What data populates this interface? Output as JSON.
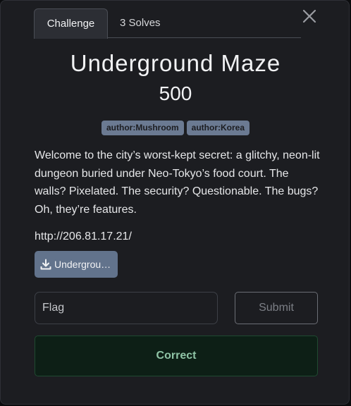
{
  "tabs": [
    {
      "label": "Challenge",
      "active": true
    },
    {
      "label": "3 Solves",
      "active": false
    }
  ],
  "challenge": {
    "name": "Underground Maze",
    "points": "500",
    "tags": [
      "author:Mushroom",
      "author:Korea"
    ],
    "description": "Welcome to the city’s worst-kept secret: a glitchy, neon-lit dungeon buried under Neo-Tokyo’s food court. The walls? Pixelated. The security? Questionable. The bugs? Oh, they’re features.",
    "url": "http://206.81.17.21/",
    "file_label": "Undergrou…"
  },
  "form": {
    "flag_placeholder": "Flag",
    "flag_value": "",
    "submit_label": "Submit",
    "result_label": "Correct"
  },
  "icons": {
    "close": "close-icon",
    "download": "download-icon"
  },
  "colors": {
    "background": "#1c1d21",
    "tag": "#6b7a92",
    "download_button": "#62738c",
    "success_bg": "#0d1f16",
    "success_text": "#8fc4a6"
  }
}
